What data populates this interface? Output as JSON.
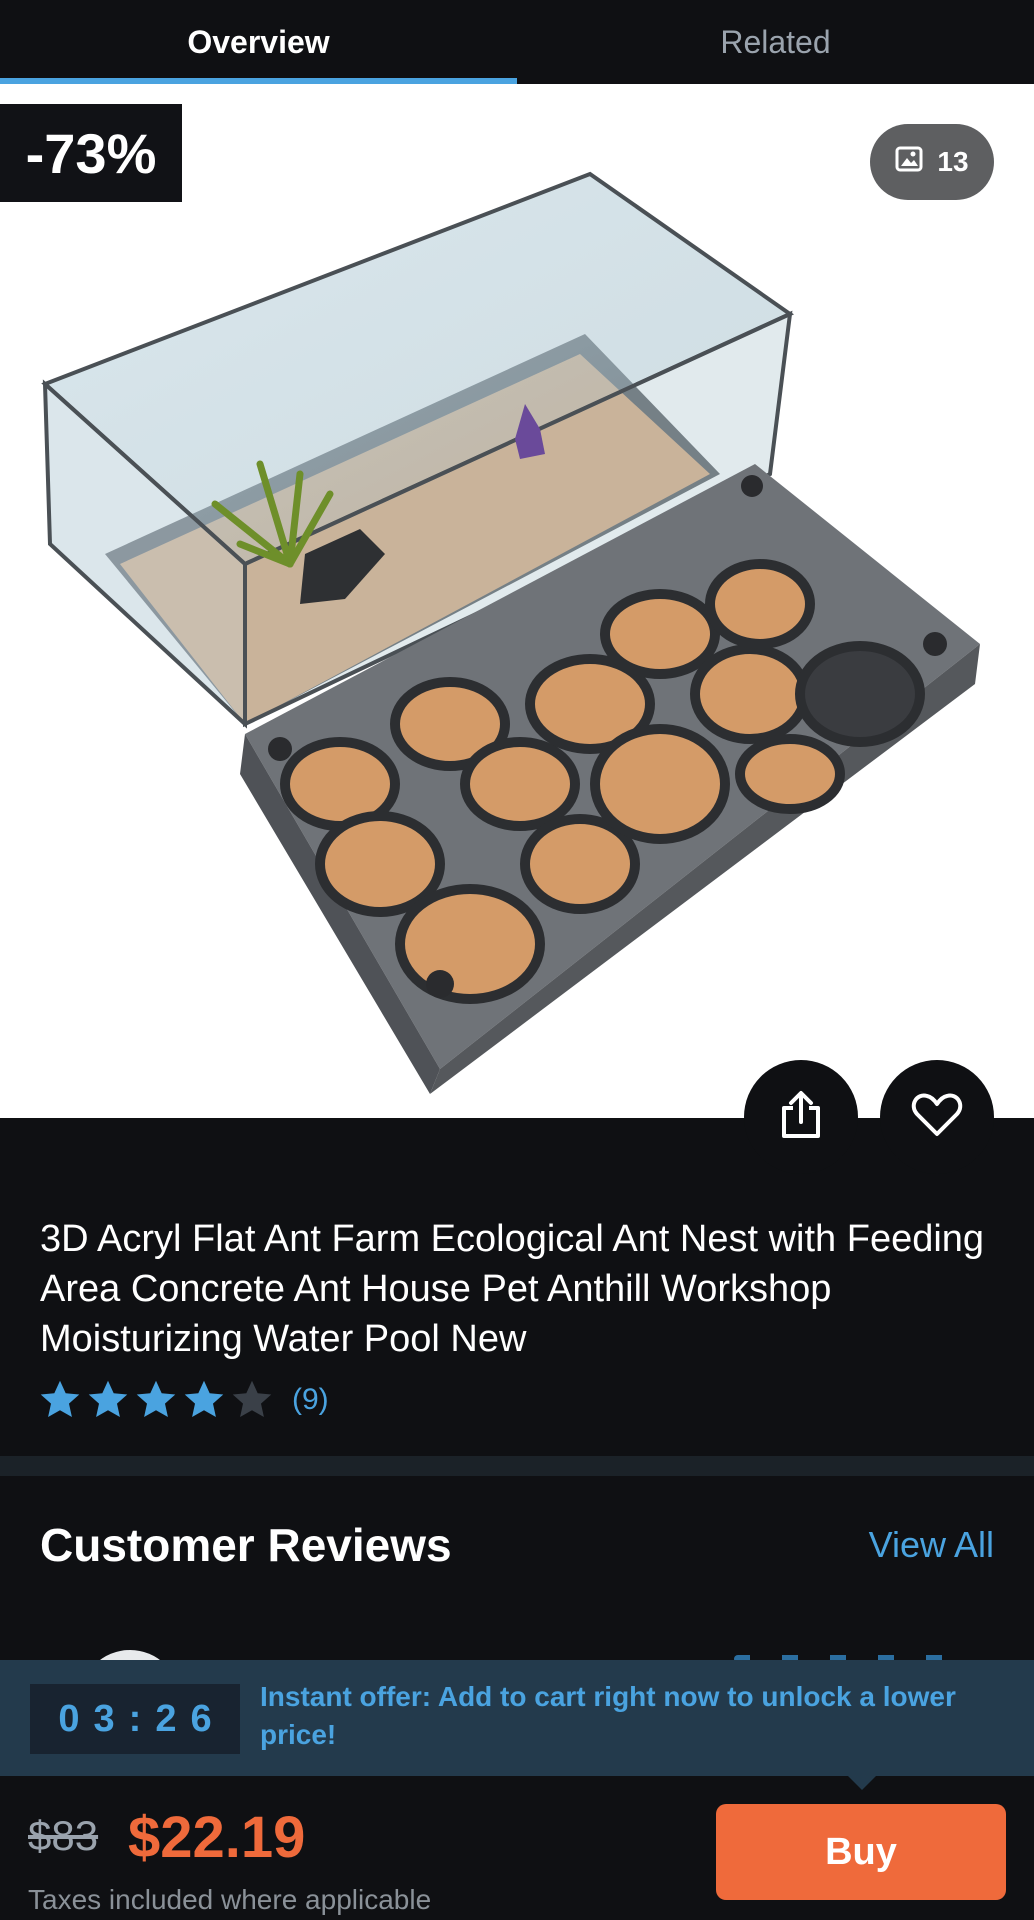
{
  "tabs": [
    {
      "label": "Overview",
      "active": true
    },
    {
      "label": "Related",
      "active": false
    }
  ],
  "hero": {
    "discount_label": "-73%",
    "photo_count": "13",
    "photo_icon": "image-icon",
    "share_icon": "share-icon",
    "favorite_icon": "heart-icon"
  },
  "product": {
    "title": "3D Acryl Flat Ant Farm Ecological Ant Nest with Feeding Area Concrete Ant House Pet Anthill Workshop Moisturizing Water Pool New",
    "rating": 4,
    "rating_max": 5,
    "rating_count": "(9)"
  },
  "reviews": {
    "title": "Customer Reviews",
    "view_all": "View All"
  },
  "offer": {
    "timer": "03:26",
    "text": "Instant offer: Add to cart right now to unlock a lower price!"
  },
  "purchase": {
    "old_price": "$83",
    "price": "$22.19",
    "tax_note": "Taxes included where applicable",
    "buy_label": "Buy"
  },
  "colors": {
    "accent_blue": "#4aa3e0",
    "price_orange": "#ef6a3b",
    "background": "#0f1013",
    "offer_banner": "#233a4c"
  }
}
